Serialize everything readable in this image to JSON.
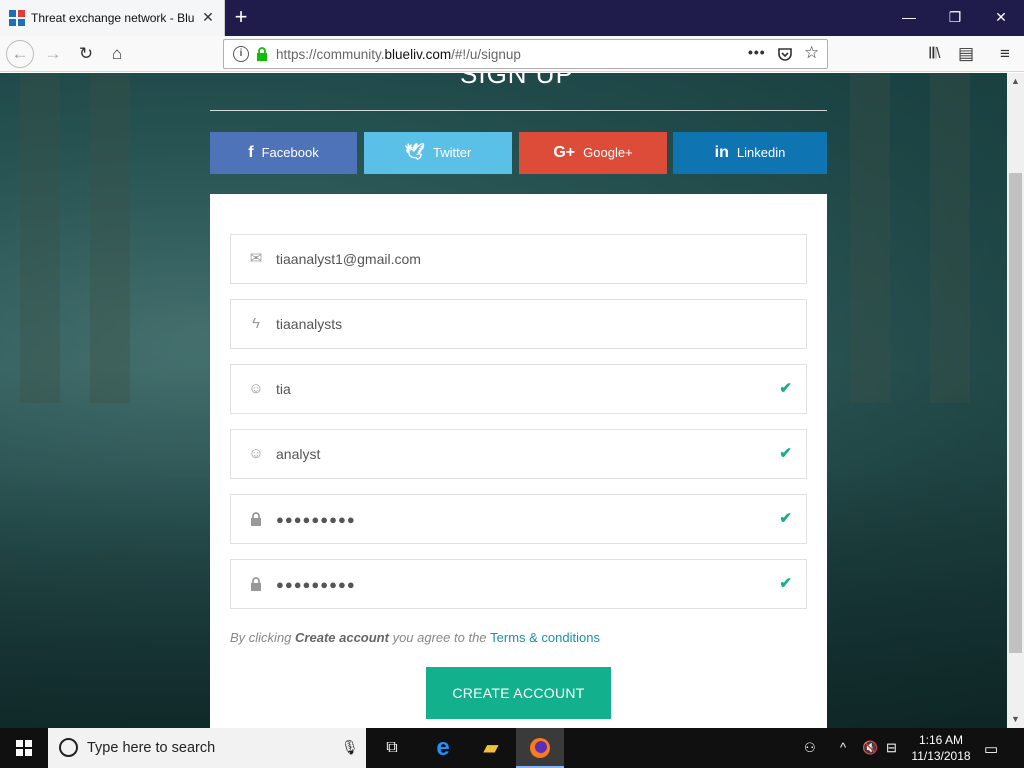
{
  "browser": {
    "tab_title": "Threat exchange network - Blu",
    "url_prefix": "https://community.",
    "url_domain": "blueliv.com",
    "url_suffix": "/#!/u/signup"
  },
  "page": {
    "heading": "SIGN UP",
    "social": {
      "facebook": "Facebook",
      "twitter": "Twitter",
      "google": "Google+",
      "linkedin": "Linkedin"
    },
    "fields": {
      "email": "tiaanalyst1@gmail.com",
      "username": "tiaanalysts",
      "first_name": "tia",
      "last_name": "analyst",
      "password": "●●●●●●●●●",
      "password_confirm": "●●●●●●●●●"
    },
    "terms_prefix": "By clicking ",
    "terms_action": "Create account",
    "terms_middle": " you agree to the ",
    "terms_link": "Terms & conditions",
    "create_button": "CREATE ACCOUNT",
    "colors": {
      "facebook": "#4f73b8",
      "twitter": "#5bc0e8",
      "google": "#dd4b39",
      "linkedin": "#0f75b2",
      "primary": "#12b08d"
    }
  },
  "taskbar": {
    "search_placeholder": "Type here to search",
    "time": "1:16 AM",
    "date": "11/13/2018"
  }
}
